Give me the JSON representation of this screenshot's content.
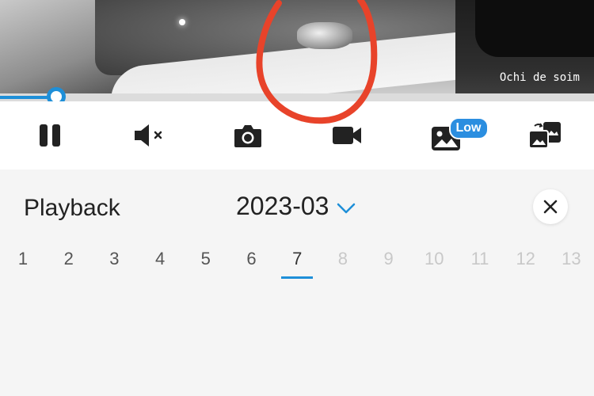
{
  "video": {
    "overlay_text": "Ochi de soim",
    "playback_progress": 0.094
  },
  "toolbar": {
    "icons": [
      "pause-icon",
      "mute-icon",
      "camera-icon",
      "video-record-icon",
      "image-quality-icon",
      "gallery-icon"
    ],
    "quality_badge": "Low"
  },
  "playback": {
    "title": "Playback",
    "month": "2023-03",
    "selected_day": "7",
    "days": [
      {
        "label": "1",
        "available": true
      },
      {
        "label": "2",
        "available": true
      },
      {
        "label": "3",
        "available": true
      },
      {
        "label": "4",
        "available": true
      },
      {
        "label": "5",
        "available": true
      },
      {
        "label": "6",
        "available": true
      },
      {
        "label": "7",
        "available": true
      },
      {
        "label": "8",
        "available": false
      },
      {
        "label": "9",
        "available": false
      },
      {
        "label": "10",
        "available": false
      },
      {
        "label": "11",
        "available": false
      },
      {
        "label": "12",
        "available": false
      },
      {
        "label": "13",
        "available": false
      }
    ]
  },
  "colors": {
    "accent": "#1e8fd8",
    "annotation": "#e8432a"
  }
}
